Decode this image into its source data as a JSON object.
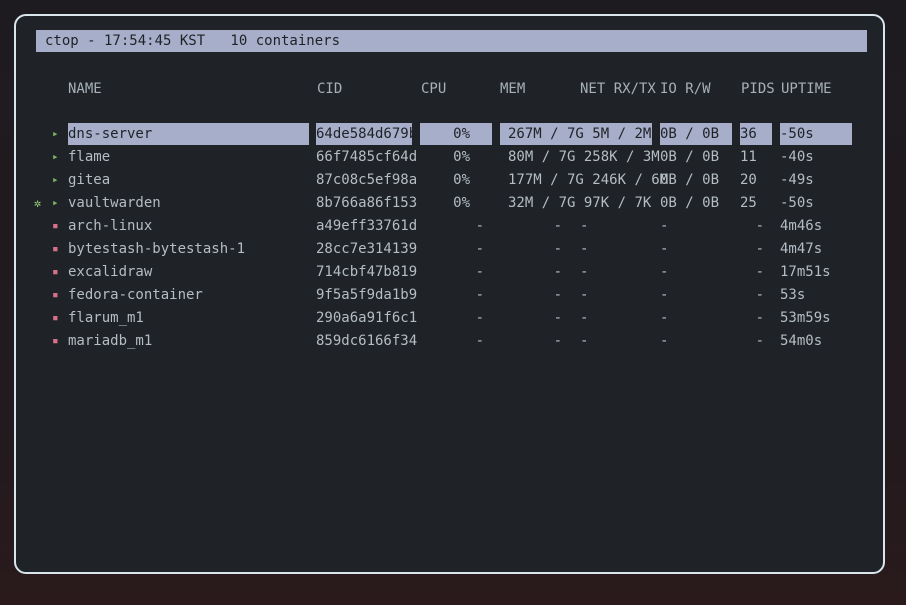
{
  "header": {
    "text": "ctop - 17:54:45 KST   10 containers"
  },
  "columns": {
    "name": "NAME",
    "cid": "CID",
    "cpu": "CPU",
    "mem": "MEM",
    "net": "NET RX/TX",
    "io": "IO R/W",
    "pids": "PIDS",
    "uptime": "UPTIME"
  },
  "rows": [
    {
      "status_icon": "▸",
      "status": "running",
      "health_icon": "",
      "name": "dns-server",
      "cid": "64de584d679b",
      "cpu": "0%",
      "mem": "267M / 7G",
      "net": "5M / 2M",
      "io": "0B / 0B",
      "pids": "36",
      "uptime": "-50s"
    },
    {
      "status_icon": "▸",
      "status": "running",
      "health_icon": "",
      "name": "flame",
      "cid": "66f7485cf64d",
      "cpu": "0%",
      "mem": "80M / 7G",
      "net": "258K / 3M",
      "io": "0B / 0B",
      "pids": "11",
      "uptime": "-40s"
    },
    {
      "status_icon": "▸",
      "status": "running",
      "health_icon": "",
      "name": "gitea",
      "cid": "87c08c5ef98a",
      "cpu": "0%",
      "mem": "177M / 7G",
      "net": "246K / 6M",
      "io": "0B / 0B",
      "pids": "20",
      "uptime": "-49s"
    },
    {
      "status_icon": "▸",
      "status": "running",
      "health_icon": "✲",
      "name": "vaultwarden",
      "cid": "8b766a86f153",
      "cpu": "0%",
      "mem": "32M / 7G",
      "net": "97K / 7K",
      "io": "0B / 0B",
      "pids": "25",
      "uptime": "-50s"
    },
    {
      "status_icon": "▪",
      "status": "stopped",
      "health_icon": "",
      "name": "arch-linux",
      "cid": "a49eff33761d",
      "cpu": "-",
      "mem": "-",
      "net": "-",
      "io": "-",
      "pids": "-",
      "uptime": "4m46s"
    },
    {
      "status_icon": "▪",
      "status": "stopped",
      "health_icon": "",
      "name": "bytestash-bytestash-1",
      "cid": "28cc7e314139",
      "cpu": "-",
      "mem": "-",
      "net": "-",
      "io": "-",
      "pids": "-",
      "uptime": "4m47s"
    },
    {
      "status_icon": "▪",
      "status": "stopped",
      "health_icon": "",
      "name": "excalidraw",
      "cid": "714cbf47b819",
      "cpu": "-",
      "mem": "-",
      "net": "-",
      "io": "-",
      "pids": "-",
      "uptime": "17m51s"
    },
    {
      "status_icon": "▪",
      "status": "stopped",
      "health_icon": "",
      "name": "fedora-container",
      "cid": "9f5a5f9da1b9",
      "cpu": "-",
      "mem": "-",
      "net": "-",
      "io": "-",
      "pids": "-",
      "uptime": "53s"
    },
    {
      "status_icon": "▪",
      "status": "stopped",
      "health_icon": "",
      "name": "flarum_m1",
      "cid": "290a6a91f6c1",
      "cpu": "-",
      "mem": "-",
      "net": "-",
      "io": "-",
      "pids": "-",
      "uptime": "53m59s"
    },
    {
      "status_icon": "▪",
      "status": "stopped",
      "health_icon": "",
      "name": "mariadb_m1",
      "cid": "859dc6166f34",
      "cpu": "-",
      "mem": "-",
      "net": "-",
      "io": "-",
      "pids": "-",
      "uptime": "54m0s"
    }
  ],
  "selected_row": 0,
  "colors": {
    "background": "#1f2327",
    "selection": "#a6aec9",
    "running": "#7fb562",
    "stopped": "#d9708a",
    "text": "#b4bcc4"
  }
}
